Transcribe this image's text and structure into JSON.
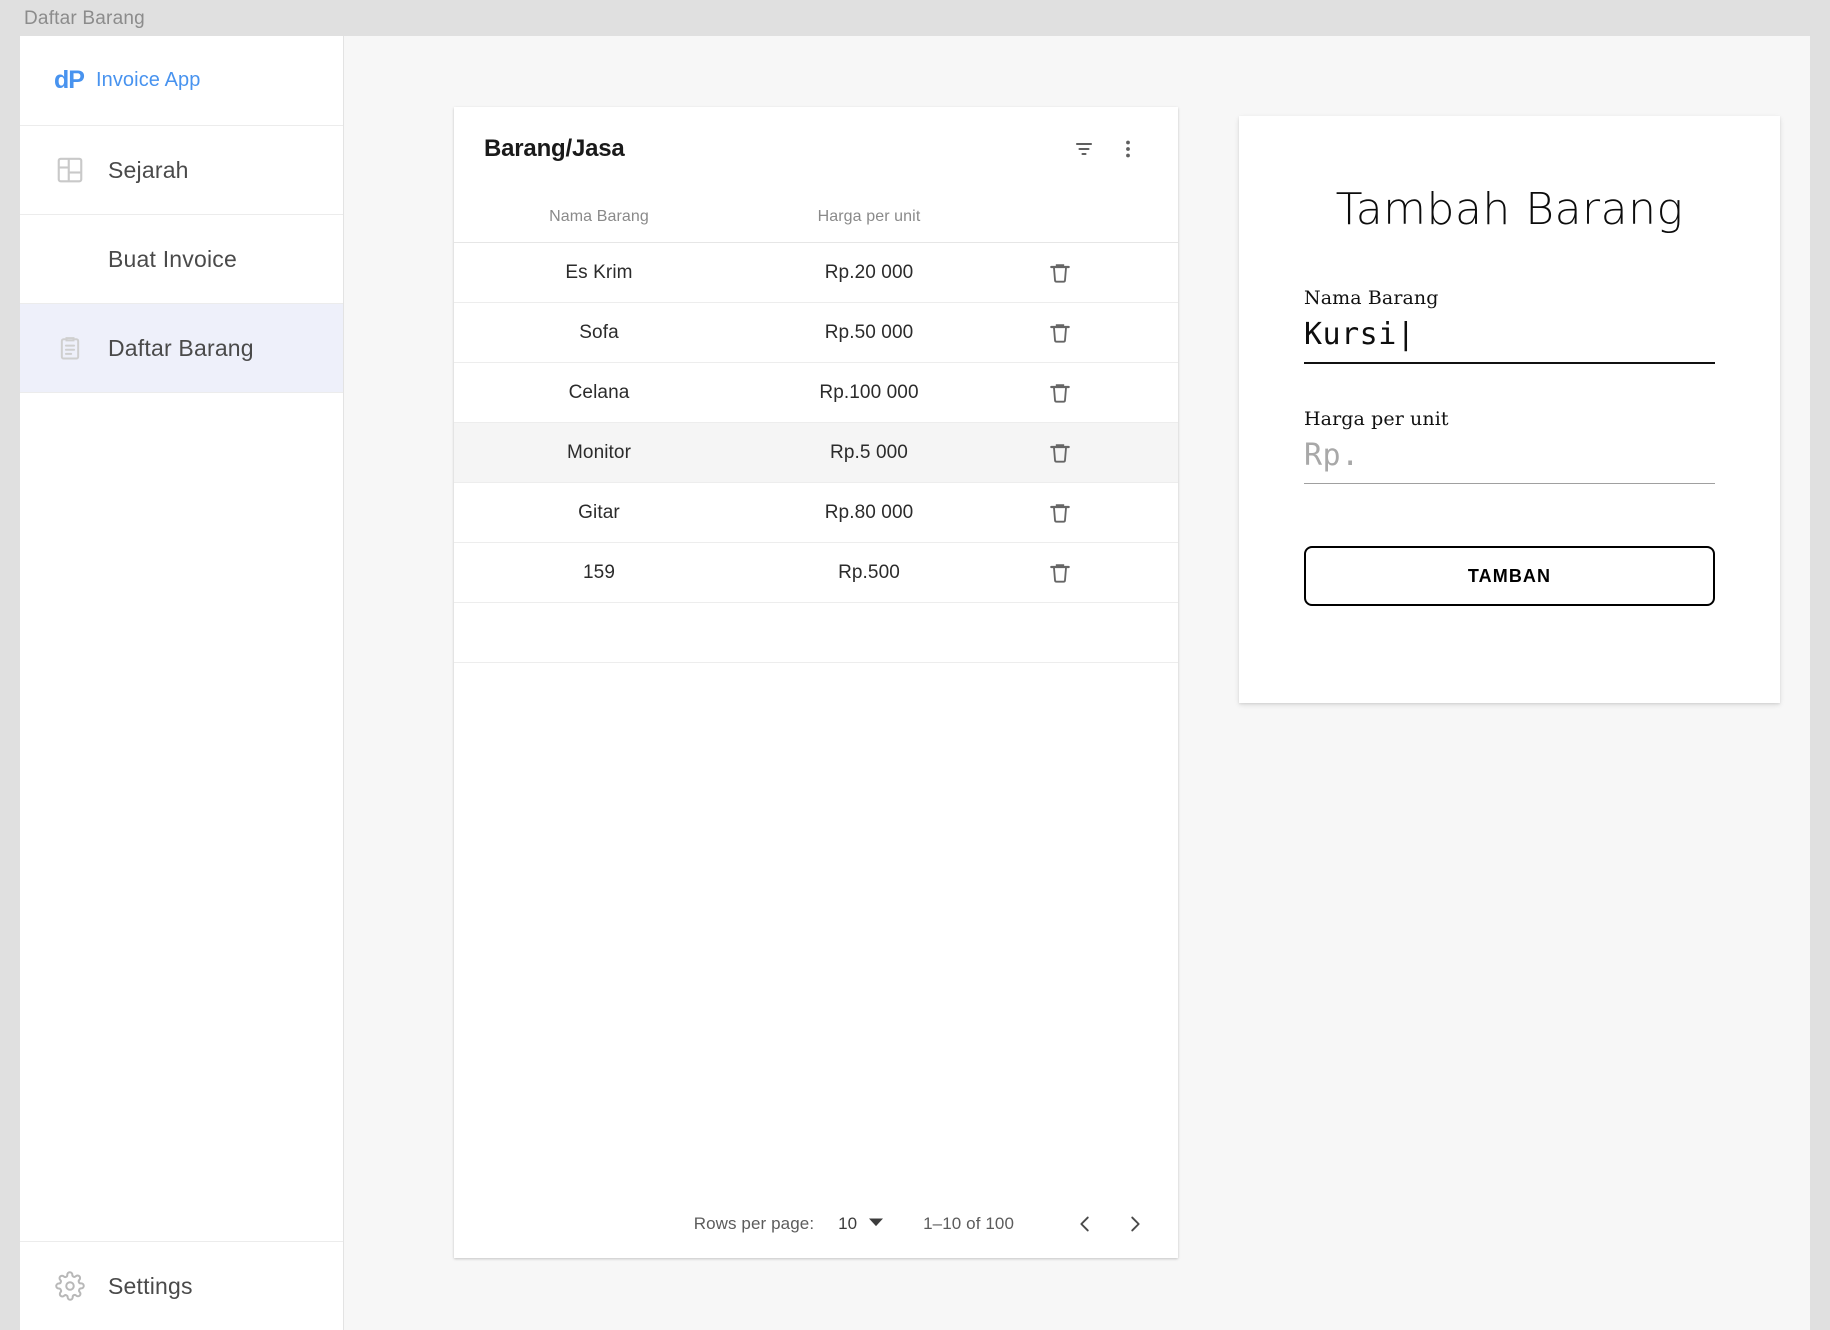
{
  "window": {
    "title": "Daftar Barang"
  },
  "sidebar": {
    "brand": {
      "logo": "dP",
      "name": "Invoice App"
    },
    "items": [
      {
        "label": "Sejarah",
        "icon": "dashboard-icon",
        "selected": false
      },
      {
        "label": "Buat Invoice",
        "icon": "",
        "selected": false
      },
      {
        "label": "Daftar Barang",
        "icon": "clipboard-icon",
        "selected": true
      }
    ],
    "settings": {
      "label": "Settings",
      "icon": "gear-icon"
    }
  },
  "table_card": {
    "title": "Barang/Jasa",
    "filter_icon": "filter-list-icon",
    "more_icon": "more-vertical-icon",
    "columns": [
      "Nama Barang",
      "Harga per unit"
    ],
    "rows": [
      {
        "nama": "Es Krim",
        "harga": "Rp.20 000",
        "hovered": false
      },
      {
        "nama": "Sofa",
        "harga": "Rp.50 000",
        "hovered": false
      },
      {
        "nama": "Celana",
        "harga": "Rp.100 000",
        "hovered": false
      },
      {
        "nama": "Monitor",
        "harga": "Rp.5 000",
        "hovered": true
      },
      {
        "nama": "Gitar",
        "harga": "Rp.80 000",
        "hovered": false
      },
      {
        "nama": "159",
        "harga": "Rp.500",
        "hovered": false
      }
    ],
    "delete_icon": "trash-icon",
    "pagination": {
      "rows_per_page_label": "Rows per page:",
      "rows_per_page_value": "10",
      "range": "1–10 of 100",
      "prev_icon": "chevron-left-icon",
      "next_icon": "chevron-right-icon"
    }
  },
  "form_card": {
    "title": "Tambah Barang",
    "fields": [
      {
        "label": "Nama Barang",
        "value": "Kursi|",
        "placeholder": ""
      },
      {
        "label": "Harga per unit",
        "value": "",
        "placeholder": "Rp."
      }
    ],
    "submit_label": "TAMBAN"
  },
  "colors": {
    "brand_blue": "#4893ef",
    "selected_nav_bg": "#eef0fa",
    "row_hover_bg": "#f5f5f5",
    "page_bg": "#e0e0e0",
    "content_bg": "#f7f7f7"
  }
}
